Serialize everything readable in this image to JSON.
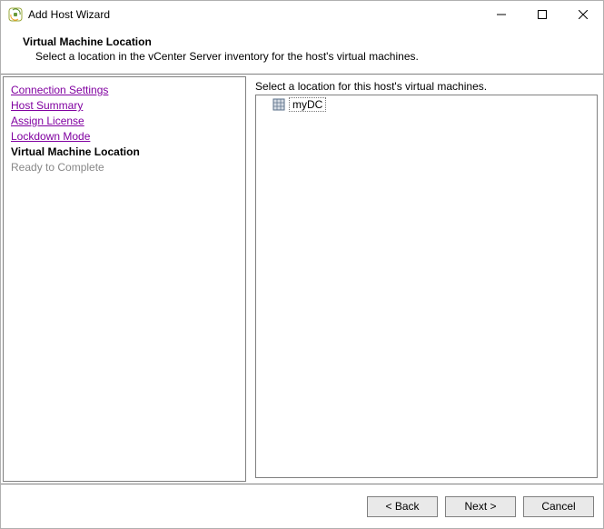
{
  "window": {
    "title": "Add Host Wizard"
  },
  "header": {
    "step_title": "Virtual Machine Location",
    "step_desc": "Select a location in the vCenter Server inventory for the host's virtual machines."
  },
  "sidebar": {
    "steps": [
      {
        "label": "Connection Settings",
        "state": "link"
      },
      {
        "label": "Host Summary",
        "state": "link"
      },
      {
        "label": "Assign License",
        "state": "link"
      },
      {
        "label": "Lockdown Mode",
        "state": "link"
      },
      {
        "label": "Virtual Machine Location",
        "state": "current"
      },
      {
        "label": "Ready to Complete",
        "state": "future"
      }
    ]
  },
  "main": {
    "instruction": "Select a location for this host's virtual machines.",
    "tree": [
      {
        "label": "myDC",
        "type": "datacenter",
        "selected": true
      }
    ]
  },
  "footer": {
    "back": "< Back",
    "next": "Next >",
    "cancel": "Cancel"
  },
  "icons": {
    "app": "vsphere-icon",
    "datacenter": "datacenter-icon"
  }
}
